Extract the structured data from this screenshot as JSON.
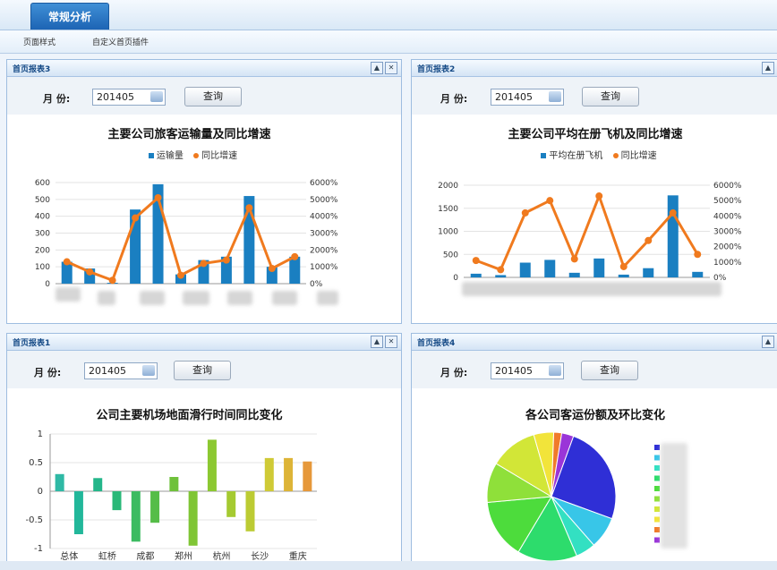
{
  "tabs": [
    {
      "label": "常规分析",
      "active": true
    }
  ],
  "toolbar": {
    "page_style": "页面样式",
    "custom_widgets": "自定义首页插件"
  },
  "colors": {
    "bar_blue": "#1a7fc1",
    "line_orange": "#f07a1e",
    "header_blue": "#1d64b4"
  },
  "panels": [
    {
      "id": "p3",
      "title": "首页报表3",
      "month_label": "月  份:",
      "month_value": "201405",
      "query_label": "查询",
      "chart_data": {
        "type": "bar",
        "title": "主要公司旅客运输量及同比增速",
        "legend": [
          "运输量",
          "同比增速"
        ],
        "y_left": {
          "min": 0,
          "max": 600,
          "ticks": [
            "600",
            "500",
            "400",
            "300",
            "200",
            "100",
            "0"
          ]
        },
        "y_right": {
          "min": 0,
          "max": 6000,
          "ticks": [
            "6000%",
            "5000%",
            "4000%",
            "3000%",
            "2000%",
            "1000%",
            "0%"
          ]
        },
        "series": [
          {
            "name": "运输量",
            "type": "bar",
            "values": [
              130,
              90,
              5,
              440,
              590,
              55,
              140,
              160,
              520,
              100,
              160
            ]
          },
          {
            "name": "同比增速",
            "type": "line",
            "values": [
              1300,
              700,
              200,
              3900,
              5100,
              500,
              1200,
              1400,
              4500,
              900,
              1600
            ]
          }
        ]
      }
    },
    {
      "id": "p2",
      "title": "首页报表2",
      "month_label": "月  份:",
      "month_value": "201405",
      "query_label": "查询",
      "chart_data": {
        "type": "bar",
        "title": "主要公司平均在册飞机及同比增速",
        "legend": [
          "平均在册飞机",
          "同比增速"
        ],
        "y_left": {
          "min": 0,
          "max": 2000,
          "ticks": [
            "2000",
            "1500",
            "1000",
            "500",
            "0"
          ]
        },
        "y_right": {
          "min": 0,
          "max": 6000,
          "ticks": [
            "6000%",
            "5000%",
            "4000%",
            "3000%",
            "2000%",
            "1000%",
            "0%"
          ]
        },
        "series": [
          {
            "name": "平均在册飞机",
            "type": "bar",
            "values": [
              80,
              50,
              320,
              380,
              100,
              410,
              60,
              200,
              1780,
              120
            ]
          },
          {
            "name": "同比增速",
            "type": "line",
            "values": [
              1100,
              500,
              4200,
              5000,
              1200,
              5300,
              700,
              2400,
              4200,
              1500
            ]
          }
        ]
      }
    },
    {
      "id": "p1",
      "title": "首页报表1",
      "month_label": "月  份:",
      "month_value": "201405",
      "query_label": "查询",
      "chart_data": {
        "type": "bar",
        "title": "公司主要机场地面滑行时间同比变化",
        "y": {
          "min": -1,
          "max": 1,
          "ticks": [
            "1",
            "0.5",
            "0",
            "-0.5",
            "-1"
          ]
        },
        "categories": [
          "总体",
          "",
          "虹桥",
          "",
          "成都",
          "",
          "郑州",
          "",
          "杭州",
          "",
          "长沙",
          "",
          "重庆",
          ""
        ],
        "values": [
          0.3,
          -0.75,
          0.23,
          -0.33,
          -0.88,
          -0.55,
          0.25,
          -0.95,
          0.9,
          -0.45,
          -0.7,
          0.58,
          0.58,
          0.52
        ],
        "bar_colors": [
          "#2fb9a5",
          "#22b79a",
          "#24b68a",
          "#2ab878",
          "#3cbb61",
          "#55bd48",
          "#6fc13b",
          "#7fc535",
          "#8cc831",
          "#a5ca31",
          "#bccb33",
          "#cfca36",
          "#ddb437",
          "#e6983a"
        ]
      }
    },
    {
      "id": "p4",
      "title": "首页报表4",
      "month_label": "月  份:",
      "month_value": "201405",
      "query_label": "查询",
      "chart_data": {
        "type": "pie",
        "title": "各公司客运份额及环比变化",
        "slices": [
          {
            "value": 25,
            "color": "#2f2fd6"
          },
          {
            "value": 8,
            "color": "#38c6e8"
          },
          {
            "value": 5,
            "color": "#33e0c2"
          },
          {
            "value": 15,
            "color": "#2ddc6c"
          },
          {
            "value": 15,
            "color": "#4ddc3c"
          },
          {
            "value": 10,
            "color": "#8fe03a"
          },
          {
            "value": 12,
            "color": "#d2e637"
          },
          {
            "value": 5,
            "color": "#f2e43a"
          },
          {
            "value": 2,
            "color": "#f07a2a"
          },
          {
            "value": 3,
            "color": "#9a35d8"
          }
        ]
      }
    }
  ]
}
